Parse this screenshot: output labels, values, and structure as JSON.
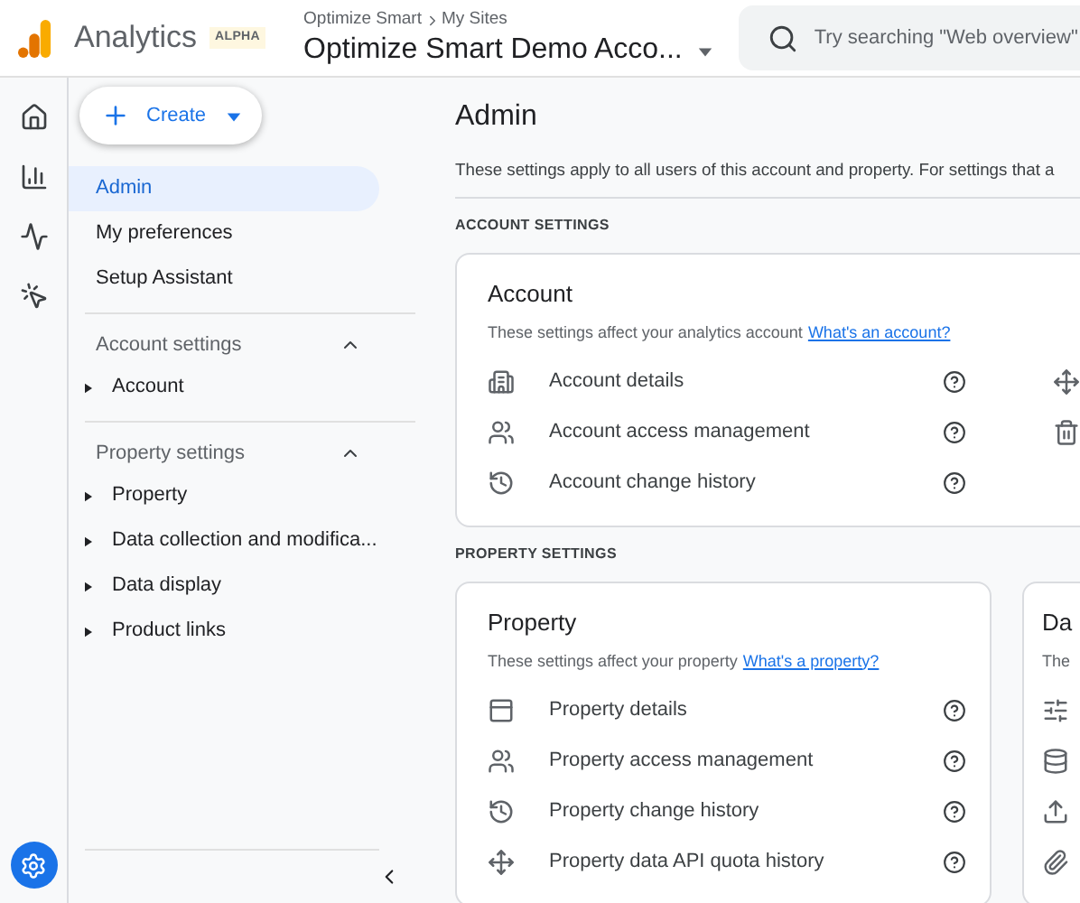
{
  "header": {
    "product": "Analytics",
    "badge": "ALPHA",
    "breadcrumb": [
      "Optimize Smart",
      "My Sites"
    ],
    "account": "Optimize Smart Demo Acco...",
    "search": {
      "placeholder": "Try searching \"Web overview\""
    }
  },
  "rail": [
    {
      "kind": "home"
    },
    {
      "kind": "reports"
    },
    {
      "kind": "explore"
    },
    {
      "kind": "advertising"
    }
  ],
  "create_button": {
    "label": "Create"
  },
  "nav": {
    "items": [
      {
        "label": "Admin",
        "selected": true
      },
      {
        "label": "My preferences",
        "selected": false
      },
      {
        "label": "Setup Assistant",
        "selected": false
      }
    ],
    "sections": [
      {
        "title": "Account settings",
        "expanded": true,
        "items": [
          {
            "label": "Account",
            "expanded": false
          }
        ]
      },
      {
        "title": "Property settings",
        "expanded": true,
        "items": [
          {
            "label": "Property",
            "expanded": false
          },
          {
            "label": "Data collection and modifica...",
            "expanded": false
          },
          {
            "label": "Data display",
            "expanded": false
          },
          {
            "label": "Product links",
            "expanded": false
          }
        ]
      }
    ]
  },
  "main": {
    "title": "Admin",
    "description": "These settings apply to all users of this account and property. For settings that a",
    "sections": [
      {
        "heading": "ACCOUNT SETTINGS",
        "cards": [
          {
            "title": "Account",
            "description": "These settings affect your analytics account",
            "link": "What's an account?",
            "rows": [
              {
                "kind": "building",
                "label": "Account details"
              },
              {
                "kind": "people",
                "label": "Account access management"
              },
              {
                "kind": "history",
                "label": "Account change history"
              }
            ],
            "column_2": [
              {
                "kind": "move"
              },
              {
                "kind": "trash"
              }
            ]
          }
        ]
      },
      {
        "heading": "PROPERTY SETTINGS",
        "cards": [
          {
            "title": "Property",
            "description": "These settings affect your property",
            "link": "What's a property?",
            "rows": [
              {
                "kind": "panel",
                "label": "Property details"
              },
              {
                "kind": "people",
                "label": "Property access management"
              },
              {
                "kind": "history",
                "label": "Property change history"
              },
              {
                "kind": "move",
                "label": "Property data API quota history"
              }
            ]
          },
          {
            "title": "Da",
            "description": "The",
            "icons": [
              {
                "kind": "sliders"
              },
              {
                "kind": "database"
              },
              {
                "kind": "upload"
              },
              {
                "kind": "paperclip"
              }
            ]
          }
        ]
      }
    ]
  }
}
